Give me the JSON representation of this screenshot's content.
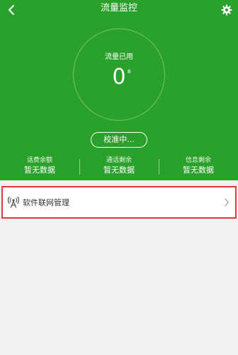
{
  "app": {
    "title": "流量监控"
  },
  "colors": {
    "header_green": "#2aa12a",
    "highlight_red": "#e53935"
  },
  "gauge": {
    "label": "流量已用",
    "value": "0",
    "unit": "B"
  },
  "calibrate": {
    "label": "校准中..."
  },
  "stats": [
    {
      "label": "话费余额",
      "value": "暂无数据"
    },
    {
      "label": "通话剩余",
      "value": "暂无数据"
    },
    {
      "label": "信息剩余",
      "value": "暂无数据"
    }
  ],
  "list": [
    {
      "label": "软件联网管理",
      "icon": "antenna-icon"
    }
  ]
}
